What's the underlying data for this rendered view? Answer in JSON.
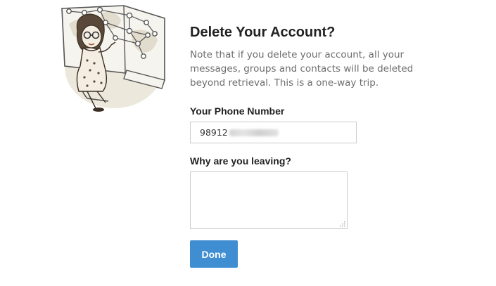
{
  "dialog": {
    "title": "Delete Your Account?",
    "note": "Note that if you delete your account, all your messages, groups and contacts will be deleted beyond retrieval. This is a one-way trip.",
    "illustration": "woman-with-network-map-illustration"
  },
  "phone": {
    "label": "Your Phone Number",
    "value_visible": "98912",
    "value_redacted": true
  },
  "reason": {
    "label": "Why are you leaving?",
    "value": ""
  },
  "actions": {
    "done_label": "Done"
  },
  "colors": {
    "button_bg": "#3f8ed1",
    "title": "#222222",
    "note_text": "#6d6d6d",
    "input_border": "#cccccc"
  }
}
